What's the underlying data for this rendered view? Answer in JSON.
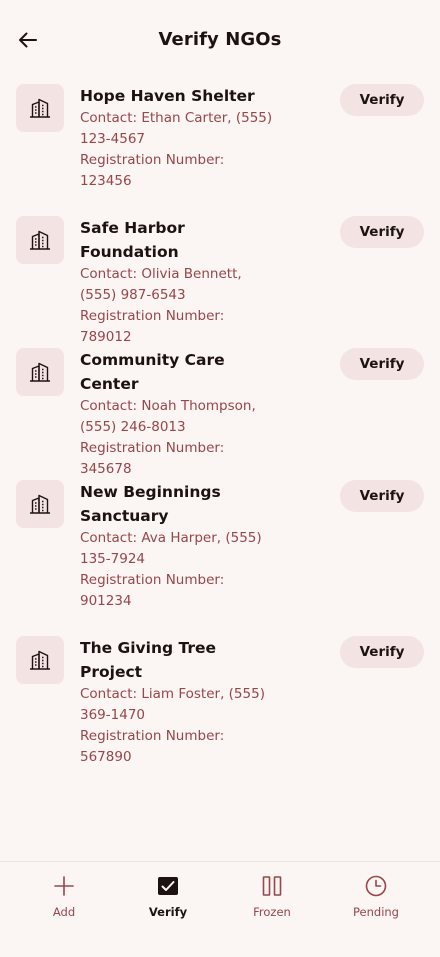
{
  "header": {
    "title": "Verify NGOs",
    "back_icon": "arrow-left-icon"
  },
  "ngos": [
    {
      "name": "Hope Haven Shelter",
      "contact": "Contact: Ethan Carter, (555) 123-4567",
      "registration": "Registration Number: 123456",
      "action": "Verify",
      "icon": "building-icon"
    },
    {
      "name": "Safe Harbor Foundation",
      "contact": "Contact: Olivia Bennett, (555) 987-6543",
      "registration": "Registration Number: 789012",
      "action": "Verify",
      "icon": "building-icon"
    },
    {
      "name": "Community Care Center",
      "contact": "Contact: Noah Thompson, (555) 246-8013",
      "registration": "Registration Number: 345678",
      "action": "Verify",
      "icon": "building-icon"
    },
    {
      "name": "New Beginnings Sanctuary",
      "contact": "Contact: Ava Harper, (555) 135-7924",
      "registration": "Registration Number: 901234",
      "action": "Verify",
      "icon": "building-icon"
    },
    {
      "name": "The Giving Tree Project",
      "contact": "Contact: Liam Foster, (555) 369-1470",
      "registration": "Registration Number: 567890",
      "action": "Verify",
      "icon": "building-icon"
    }
  ],
  "bottom_nav": {
    "items": [
      {
        "label": "Add",
        "icon": "plus-icon",
        "active": false
      },
      {
        "label": "Verify",
        "icon": "checkbox-icon",
        "active": true
      },
      {
        "label": "Frozen",
        "icon": "pause-icon",
        "active": false
      },
      {
        "label": "Pending",
        "icon": "clock-icon",
        "active": false
      }
    ]
  },
  "colors": {
    "background": "#fbf5f4",
    "text_primary": "#1c1212",
    "text_secondary": "#97464a",
    "chip_background": "#f3e3e2"
  }
}
